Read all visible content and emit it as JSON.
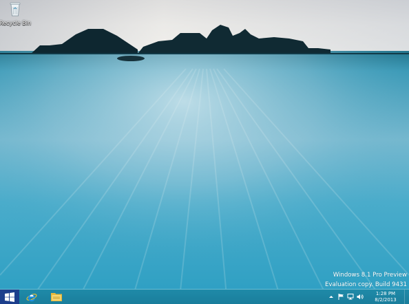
{
  "desktop": {
    "icons": [
      {
        "label": "Recycle Bin",
        "icon": "recycle-bin-icon"
      }
    ],
    "watermark": {
      "line1": "Windows 8.1 Pro Preview",
      "line2": "Evaluation copy. Build 9431"
    }
  },
  "taskbar": {
    "start": {
      "icon": "windows-logo-icon"
    },
    "pinned": [
      {
        "icon": "internet-explorer-icon"
      },
      {
        "icon": "file-explorer-icon"
      }
    ],
    "tray": {
      "icons": [
        "show-hidden-icons-chevron",
        "action-center-flag-icon",
        "network-icon",
        "volume-icon"
      ],
      "time": "1:28 PM",
      "date": "8/2/2013"
    },
    "colors": {
      "taskbar": "#1f8aa8",
      "start_button": "#1c3e8c"
    }
  }
}
